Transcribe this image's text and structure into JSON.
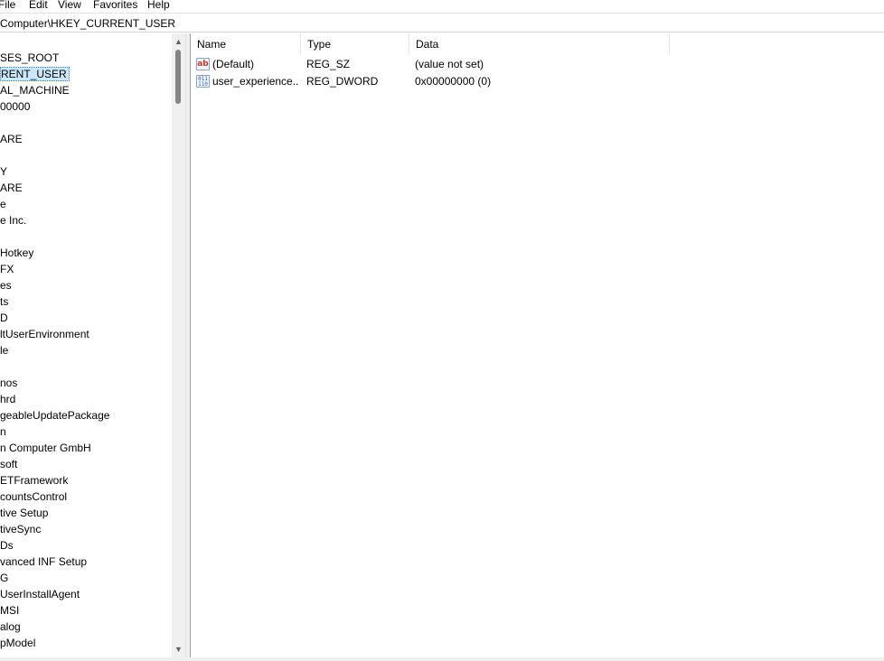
{
  "menu": {
    "items": [
      {
        "label": "File"
      },
      {
        "label": "Edit"
      },
      {
        "label": "View"
      },
      {
        "label": "Favorites"
      },
      {
        "label": "Help"
      }
    ]
  },
  "address": {
    "path": "Computer\\HKEY_CURRENT_USER"
  },
  "tree": {
    "items": [
      {
        "label": "SES_ROOT"
      },
      {
        "label": "RENT_USER",
        "selected": true
      },
      {
        "label": "AL_MACHINE"
      },
      {
        "label": "00000"
      },
      {
        "label": ""
      },
      {
        "label": "ARE"
      },
      {
        "label": ""
      },
      {
        "label": "Y"
      },
      {
        "label": "ARE"
      },
      {
        "label": "e"
      },
      {
        "label": "e Inc."
      },
      {
        "label": ""
      },
      {
        "label": "Hotkey"
      },
      {
        "label": "FX"
      },
      {
        "label": "es"
      },
      {
        "label": "ts"
      },
      {
        "label": "D"
      },
      {
        "label": "ltUserEnvironment"
      },
      {
        "label": "le"
      },
      {
        "label": ""
      },
      {
        "label": "nos"
      },
      {
        "label": "hrd"
      },
      {
        "label": "geableUpdatePackage"
      },
      {
        "label": "n"
      },
      {
        "label": "n Computer GmbH"
      },
      {
        "label": "soft"
      },
      {
        "label": "ETFramework"
      },
      {
        "label": "countsControl"
      },
      {
        "label": "tive Setup"
      },
      {
        "label": "tiveSync"
      },
      {
        "label": "Ds"
      },
      {
        "label": "vanced INF Setup"
      },
      {
        "label": "G"
      },
      {
        "label": "UserInstallAgent"
      },
      {
        "label": "MSI"
      },
      {
        "label": "alog"
      },
      {
        "label": "pModel"
      }
    ]
  },
  "list": {
    "columns": [
      {
        "label": "Name"
      },
      {
        "label": "Type"
      },
      {
        "label": "Data"
      }
    ],
    "rows": [
      {
        "icon": "string-value-icon",
        "icon_text": "ab",
        "name": "(Default)",
        "type": "REG_SZ",
        "data": "(value not set)"
      },
      {
        "icon": "binary-value-icon",
        "icon_text": "011\n110",
        "name": "user_experience...",
        "type": "REG_DWORD",
        "data": "0x00000000 (0)"
      }
    ]
  },
  "scroll": {
    "up_glyph": "▲",
    "down_glyph": "▼"
  }
}
